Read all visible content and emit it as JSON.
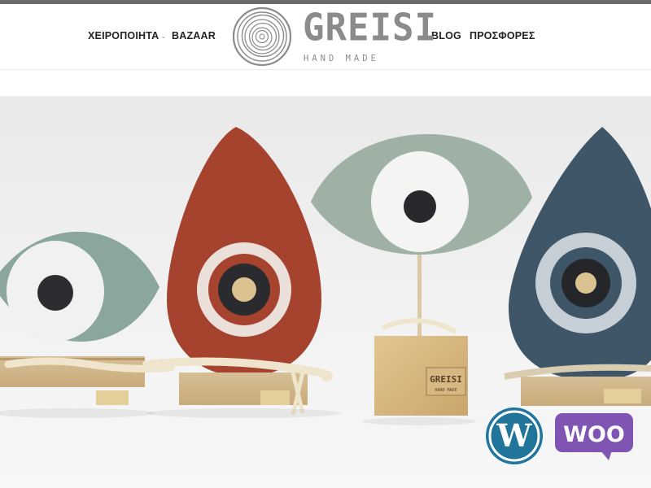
{
  "nav": {
    "left": [
      {
        "label": "ΧΕΙΡΟΠΟΙΗΤΑ",
        "has_dropdown": true
      },
      {
        "label": "BAZAAR"
      }
    ],
    "right": [
      {
        "label": "BLOG"
      },
      {
        "label": "ΠΡΟΣΦΟΡΕΣ"
      }
    ]
  },
  "logo": {
    "name": "GREISI",
    "tagline": "HAND MADE"
  },
  "hero": {
    "stamp_text": "GREISI",
    "stamp_sub": "HAND MADE"
  },
  "badges": {
    "wordpress_icon": "wordpress-logo",
    "woo_label": "WOO",
    "wordpress_color": "#21759b",
    "woo_color": "#7f54b3"
  },
  "colors": {
    "topbar": "#6c6c6c",
    "logo_gray": "#8b8b8b",
    "nav_text": "#222222"
  }
}
